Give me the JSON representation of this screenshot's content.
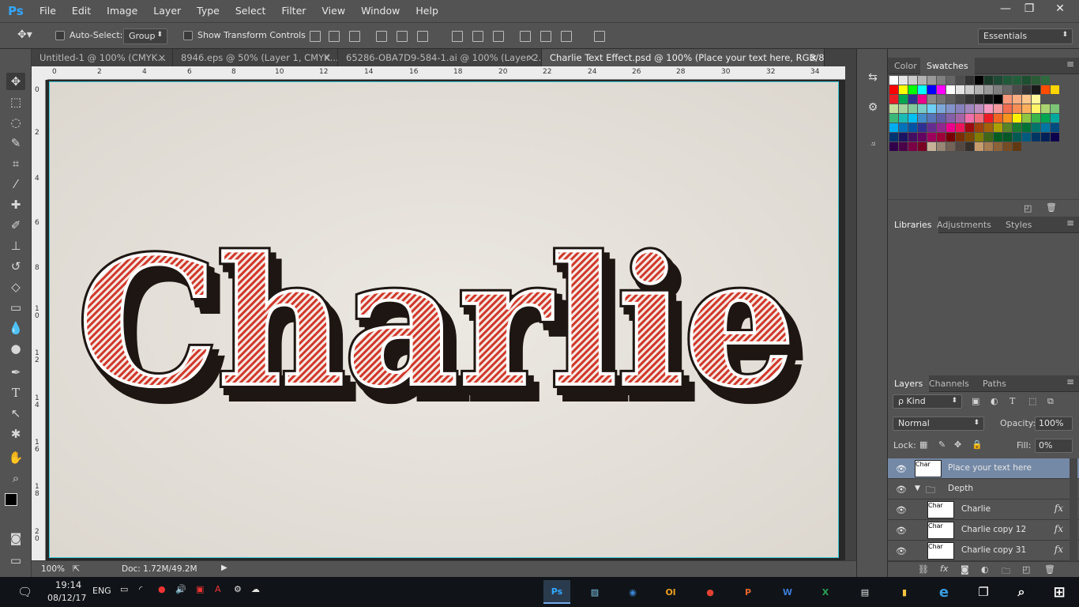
{
  "app": {
    "logo": "Ps"
  },
  "menu": [
    "File",
    "Edit",
    "Image",
    "Layer",
    "Type",
    "Select",
    "Filter",
    "View",
    "Window",
    "Help"
  ],
  "window_controls": {
    "minimize": "—",
    "restore": "❐",
    "close": "✕"
  },
  "options": {
    "auto_select_label": "Auto-Select:",
    "auto_select_value": "Group",
    "show_transform_label": "Show Transform Controls",
    "workspace": "Essentials"
  },
  "tabs": [
    {
      "label": "Untitled-1 @ 100% (CMYK...",
      "close": "×"
    },
    {
      "label": "8946.eps @ 50% (Layer 1, CMYK...",
      "close": "×"
    },
    {
      "label": "65286-OBA7D9-584-1.ai @ 100% (Layer 2...",
      "close": "×"
    },
    {
      "label": "Charlie Text Effect.psd @ 100% (Place your text here, RGB/8) *",
      "close": "×"
    }
  ],
  "ruler": {
    "h_ticks": [
      "0",
      "2",
      "4",
      "6",
      "8",
      "10",
      "12",
      "14",
      "16",
      "18",
      "20",
      "22",
      "24",
      "26",
      "28",
      "30",
      "32",
      "34"
    ],
    "v_ticks": [
      "0",
      "2",
      "4",
      "6",
      "8",
      "1\n0",
      "1\n2",
      "1\n4",
      "1\n6",
      "1\n8",
      "2\n0"
    ]
  },
  "canvas": {
    "text": "Charlie",
    "background_color": "#e9e5df",
    "fill_color": "#d0372a",
    "outline_color": "#1e1612"
  },
  "status": {
    "zoom": "100%",
    "doc": "Doc: 1.72M/49.2M"
  },
  "swatch_panel": {
    "tabs": [
      "Color",
      "Swatches"
    ],
    "active": "Swatches",
    "rows": [
      [
        "#ffffff",
        "#e6e6e6",
        "#cccccc",
        "#b3b3b3",
        "#999999",
        "#808080",
        "#666666",
        "#4d4d4d",
        "#333333",
        "#000000",
        "#1a3a2a",
        "#1f4a35",
        "#205a3a",
        "#235e3b",
        "#1d5031",
        "#2a5a36",
        "#2e6a3e"
      ],
      [
        "#ff0000",
        "#ffff00",
        "#00ff00",
        "#00ffff",
        "#0000ff",
        "#ff00ff",
        "#ffffff",
        "#e5e5e5",
        "#cccccc",
        "#b2b2b2",
        "#999999",
        "#7f7f7f",
        "#666666",
        "#4c4c4c",
        "#333333",
        "#191919",
        "#ff4d00",
        "#ffd400"
      ],
      [
        "#ec1c24",
        "#00a650",
        "#2e3192",
        "#ec008c",
        "#898989",
        "#747474",
        "#5e5e5e",
        "#494949",
        "#363636",
        "#232323",
        "#131313",
        "#000000",
        "#f7977a",
        "#f9ad81",
        "#fdc68a",
        "#fff79a"
      ],
      [
        "#c4df9b",
        "#a3d39c",
        "#82ca9c",
        "#7accc8",
        "#6dcff6",
        "#7da7d9",
        "#8393ca",
        "#8781bd",
        "#a187be",
        "#bc8dbf",
        "#f49ac1",
        "#f5989d",
        "#f26c4f",
        "#f68e55",
        "#fbaf5c",
        "#fff467",
        "#acd372",
        "#7cc576"
      ],
      [
        "#3bb878",
        "#1abbb4",
        "#00bff3",
        "#438ccb",
        "#5574b9",
        "#605ca8",
        "#855fa8",
        "#a763a8",
        "#f06ea9",
        "#f26d7d",
        "#ed1c24",
        "#f26522",
        "#f7941d",
        "#fff200",
        "#8dc63f",
        "#39b54a",
        "#00a651",
        "#00a99d"
      ],
      [
        "#00aeef",
        "#0072bc",
        "#0054a6",
        "#2e3192",
        "#662d91",
        "#92278f",
        "#ec008c",
        "#ed145b",
        "#9e0b0f",
        "#a0410d",
        "#a36209",
        "#aba000",
        "#598527",
        "#1a7b30",
        "#007236",
        "#00746b",
        "#0076a3",
        "#004b80"
      ],
      [
        "#003471",
        "#1b1464",
        "#440e62",
        "#630460",
        "#9e005d",
        "#9e0039",
        "#790000",
        "#7b2e00",
        "#7d4900",
        "#827b00",
        "#406618",
        "#005e20",
        "#005826",
        "#005952",
        "#005b7f",
        "#003663",
        "#002157",
        "#0d004c"
      ],
      [
        "#32004b",
        "#4b0049",
        "#7b0046",
        "#7a0026",
        "#c7b299",
        "#998675",
        "#736357",
        "#534741",
        "#37302a",
        "#c69c6d",
        "#a67c52",
        "#8c6239",
        "#754c24",
        "#603913"
      ]
    ]
  },
  "lib_panel": {
    "tabs": [
      "Libraries",
      "Adjustments",
      "Styles"
    ],
    "active": "Libraries"
  },
  "layers_panel": {
    "tabs": [
      "Layers",
      "Channels",
      "Paths"
    ],
    "active": "Layers",
    "kind_label": "ρ Kind",
    "blend_mode": "Normal",
    "opacity_label": "Opacity:",
    "opacity_value": "100%",
    "lock_label": "Lock:",
    "fill_label": "Fill:",
    "fill_value": "0%",
    "layers": [
      {
        "name": "Place your text here",
        "selected": true,
        "fx": ""
      },
      {
        "name": "Depth",
        "group": true,
        "fx": ""
      },
      {
        "name": "Charlie",
        "fx": "fx"
      },
      {
        "name": "Charlie copy 12",
        "fx": "fx"
      },
      {
        "name": "Charlie copy 31",
        "fx": "fx"
      }
    ]
  },
  "taskbar": {
    "time": "19:14",
    "date": "08/12/17",
    "lang": "ENG",
    "apps": [
      "Ps",
      "▨",
      "◉",
      "Ol",
      "●",
      "P",
      "W",
      "X",
      "▤",
      "▮",
      "e",
      "❐",
      "⌕",
      "⊞"
    ]
  }
}
